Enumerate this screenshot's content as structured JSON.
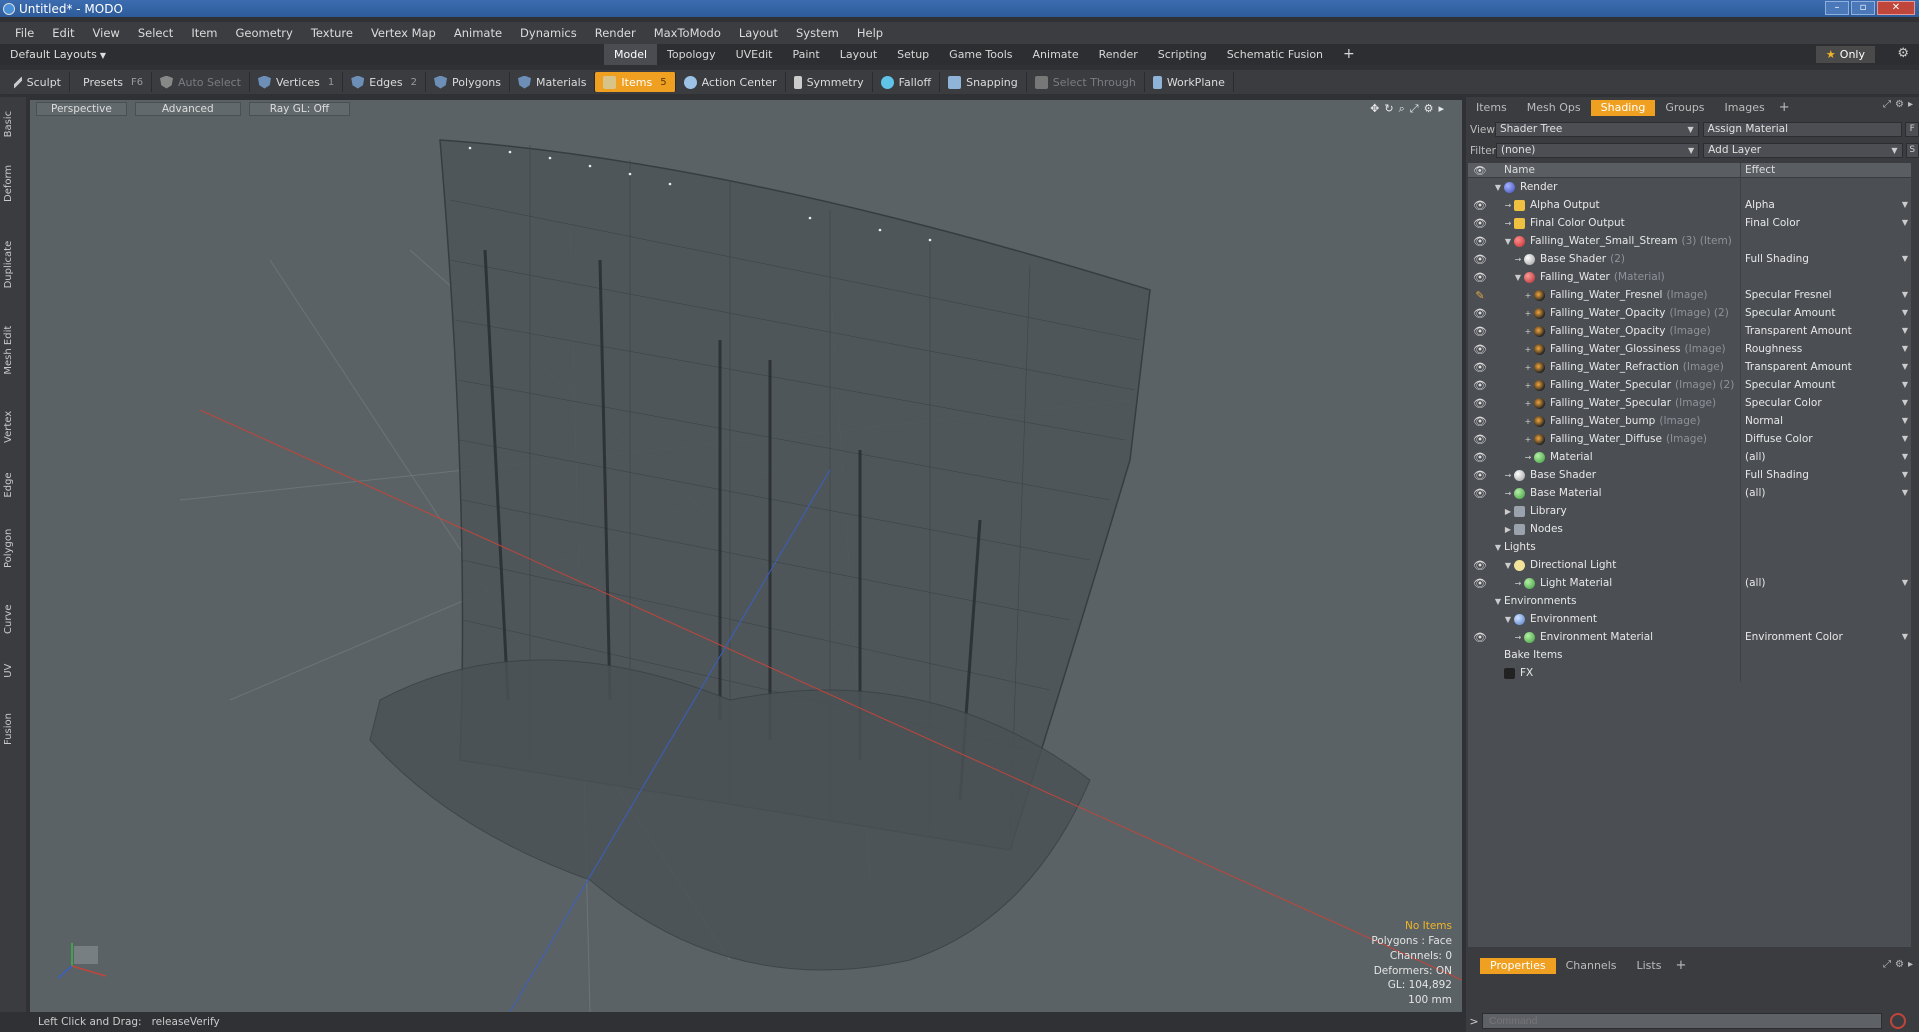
{
  "window": {
    "title": "Untitled* - MODO"
  },
  "menu": [
    "File",
    "Edit",
    "View",
    "Select",
    "Item",
    "Geometry",
    "Texture",
    "Vertex Map",
    "Animate",
    "Dynamics",
    "Render",
    "MaxToModo",
    "Layout",
    "System",
    "Help"
  ],
  "layout_selector": "Default Layouts",
  "layout_tabs": [
    "Model",
    "Topology",
    "UVEdit",
    "Paint",
    "Layout",
    "Setup",
    "Game Tools",
    "Animate",
    "Render",
    "Scripting",
    "Schematic Fusion",
    "+"
  ],
  "active_layout_tab": "Model",
  "only_button": "Only",
  "toolbar": {
    "sculpt": "Sculpt",
    "presets": "Presets",
    "presets_key": "F6",
    "auto_select": "Auto Select",
    "vertices": "Vertices",
    "vertices_key": "1",
    "edges": "Edges",
    "edges_key": "2",
    "polygons": "Polygons",
    "materials": "Materials",
    "items": "Items",
    "items_key": "5",
    "action_center": "Action Center",
    "symmetry": "Symmetry",
    "falloff": "Falloff",
    "snapping": "Snapping",
    "select_through": "Select Through",
    "workplane": "WorkPlane"
  },
  "left_palette": [
    "Basic",
    "Deform",
    "Duplicate",
    "Mesh Edit",
    "Vertex",
    "Edge",
    "Polygon",
    "Curve",
    "UV",
    "Fusion"
  ],
  "viewport": {
    "view_mode": "Perspective",
    "advanced": "Advanced",
    "raygl": "Ray GL: Off",
    "hud": {
      "items": "No Items",
      "polygons": "Polygons : Face",
      "channels": "Channels: 0",
      "deformers": "Deformers: ON",
      "gl": "GL: 104,892",
      "scale": "100 mm"
    }
  },
  "status": {
    "label": "Left Click and Drag:",
    "value": "releaseVerify"
  },
  "right_panel": {
    "tabs": [
      "Items",
      "Mesh Ops",
      "Shading",
      "Groups",
      "Images",
      "+"
    ],
    "active_tab": "Shading",
    "view_label": "View",
    "view_value": "Shader Tree",
    "assign_material": "Assign Material",
    "f_button": "F",
    "filter_label": "Filter",
    "filter_value": "(none)",
    "add_layer": "Add Layer",
    "s_button": "S",
    "columns": {
      "name": "Name",
      "effect": "Effect"
    },
    "tree": [
      {
        "name": "Render",
        "suffix": "",
        "effect": "",
        "depth": 0,
        "exp": "▼",
        "icon": "ic-render",
        "eye": false
      },
      {
        "name": "Alpha Output",
        "suffix": "",
        "effect": "Alpha",
        "depth": 1,
        "exp": "→",
        "icon": "ic-output",
        "eye": true
      },
      {
        "name": "Final Color Output",
        "suffix": "",
        "effect": "Final Color",
        "depth": 1,
        "exp": "→",
        "icon": "ic-output",
        "eye": true
      },
      {
        "name": "Falling_Water_Small_Stream",
        "suffix": "(3) (Item)",
        "effect": "",
        "depth": 1,
        "exp": "▼",
        "icon": "ic-group",
        "eye": true
      },
      {
        "name": "Base Shader",
        "suffix": "(2)",
        "effect": "Full Shading",
        "depth": 2,
        "exp": "→",
        "icon": "ic-shader",
        "eye": true
      },
      {
        "name": "Falling_Water",
        "suffix": "(Material)",
        "effect": "",
        "depth": 2,
        "exp": "▼",
        "icon": "ic-mat",
        "eye": true
      },
      {
        "name": "Falling_Water_Fresnel",
        "suffix": "(Image)",
        "effect": "Specular Fresnel",
        "depth": 3,
        "exp": "+",
        "icon": "ic-image",
        "eye": "brush"
      },
      {
        "name": "Falling_Water_Opacity",
        "suffix": "(Image) (2)",
        "effect": "Specular Amount",
        "depth": 3,
        "exp": "+",
        "icon": "ic-image",
        "eye": true
      },
      {
        "name": "Falling_Water_Opacity",
        "suffix": "(Image)",
        "effect": "Transparent Amount",
        "depth": 3,
        "exp": "+",
        "icon": "ic-image",
        "eye": true
      },
      {
        "name": "Falling_Water_Glossiness",
        "suffix": "(Image)",
        "effect": "Roughness",
        "depth": 3,
        "exp": "+",
        "icon": "ic-image",
        "eye": true
      },
      {
        "name": "Falling_Water_Refraction",
        "suffix": "(Image)",
        "effect": "Transparent Amount",
        "depth": 3,
        "exp": "+",
        "icon": "ic-image",
        "eye": true
      },
      {
        "name": "Falling_Water_Specular",
        "suffix": "(Image) (2)",
        "effect": "Specular Amount",
        "depth": 3,
        "exp": "+",
        "icon": "ic-image",
        "eye": true
      },
      {
        "name": "Falling_Water_Specular",
        "suffix": "(Image)",
        "effect": "Specular Color",
        "depth": 3,
        "exp": "+",
        "icon": "ic-image",
        "eye": true
      },
      {
        "name": "Falling_Water_bump",
        "suffix": "(Image)",
        "effect": "Normal",
        "depth": 3,
        "exp": "+",
        "icon": "ic-image",
        "eye": true
      },
      {
        "name": "Falling_Water_Diffuse",
        "suffix": "(Image)",
        "effect": "Diffuse Color",
        "depth": 3,
        "exp": "+",
        "icon": "ic-image",
        "eye": true
      },
      {
        "name": "Material",
        "suffix": "",
        "effect": "(all)",
        "depth": 3,
        "exp": "→",
        "icon": "ic-green",
        "eye": true
      },
      {
        "name": "Base Shader",
        "suffix": "",
        "effect": "Full Shading",
        "depth": 1,
        "exp": "→",
        "icon": "ic-shader",
        "eye": true
      },
      {
        "name": "Base Material",
        "suffix": "",
        "effect": "(all)",
        "depth": 1,
        "exp": "→",
        "icon": "ic-green",
        "eye": true
      },
      {
        "name": "Library",
        "suffix": "",
        "effect": "",
        "depth": 1,
        "exp": "▶",
        "icon": "ic-folder",
        "eye": false
      },
      {
        "name": "Nodes",
        "suffix": "",
        "effect": "",
        "depth": 1,
        "exp": "▶",
        "icon": "ic-folder",
        "eye": false
      },
      {
        "name": "Lights",
        "suffix": "",
        "effect": "",
        "depth": 0,
        "exp": "▼",
        "icon": "",
        "eye": false
      },
      {
        "name": "Directional Light",
        "suffix": "",
        "effect": "",
        "depth": 1,
        "exp": "▼",
        "icon": "ic-light",
        "eye": true
      },
      {
        "name": "Light Material",
        "suffix": "",
        "effect": "(all)",
        "depth": 2,
        "exp": "→",
        "icon": "ic-green",
        "eye": true
      },
      {
        "name": "Environments",
        "suffix": "",
        "effect": "",
        "depth": 0,
        "exp": "▼",
        "icon": "",
        "eye": false
      },
      {
        "name": "Environment",
        "suffix": "",
        "effect": "",
        "depth": 1,
        "exp": "▼",
        "icon": "ic-env",
        "eye": false
      },
      {
        "name": "Environment Material",
        "suffix": "",
        "effect": "Environment Color",
        "depth": 2,
        "exp": "→",
        "icon": "ic-green",
        "eye": true
      },
      {
        "name": "Bake Items",
        "suffix": "",
        "effect": "",
        "depth": 0,
        "exp": "",
        "icon": "",
        "eye": false
      },
      {
        "name": "FX",
        "suffix": "",
        "effect": "",
        "depth": 0,
        "exp": "",
        "icon": "ic-fx",
        "eye": false
      }
    ],
    "bottom_tabs": [
      "Properties",
      "Channels",
      "Lists",
      "+"
    ],
    "active_bottom_tab": "Properties",
    "command_placeholder": "Command"
  },
  "colors": {
    "accent": "#f0a020",
    "viewport_bg": "#5a6265",
    "x_axis": "#c0453a",
    "z_axis": "#3a5fc0"
  }
}
